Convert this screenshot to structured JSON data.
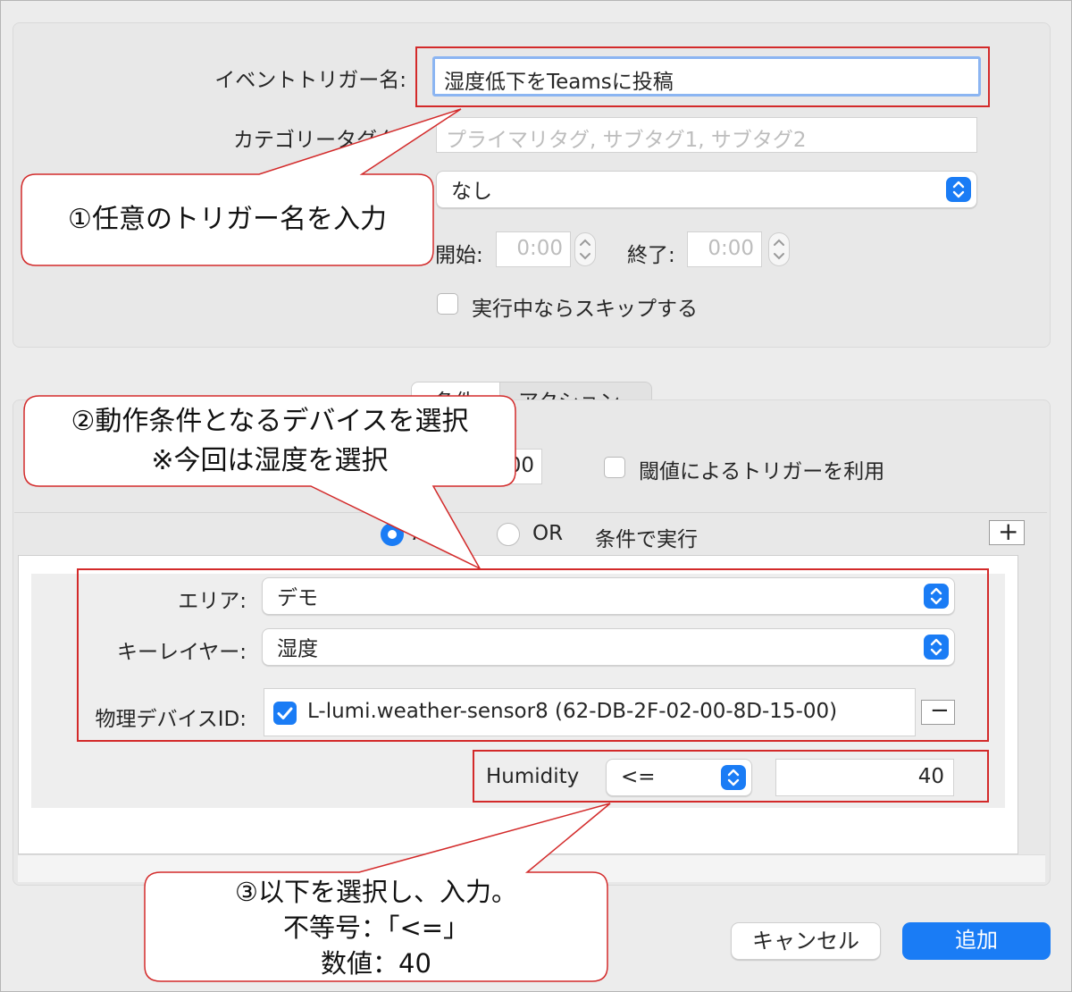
{
  "trigger_form": {
    "event_name_label": "イベントトリガー名:",
    "event_name_value": "湿度低下をTeamsに投稿",
    "category_label": "カテゴリータグタ",
    "category_placeholder": "プライマリタグ, サブタグ1, サブタグ2",
    "schedule_value": "なし",
    "start_label": "開始:",
    "start_value": "0:00",
    "end_label": "終了:",
    "end_value": "0:00",
    "skip_label": "実行中ならスキップする"
  },
  "tabs": [
    {
      "label": "条件",
      "selected": true
    },
    {
      "label": "アクション",
      "selected": false
    }
  ],
  "conditions": {
    "partial_value": "00",
    "threshold_label": "閾値によるトリガーを利用",
    "and_label": "AND",
    "or_label": "OR",
    "run_suffix": "条件で実行",
    "add_symbol": "+",
    "area_label": "エリア:",
    "area_value": "デモ",
    "layer_label": "キーレイヤー:",
    "layer_value": "湿度",
    "device_label": "物理デバイスID:",
    "device_value": "L-lumi.weather-sensor8 (62-DB-2F-02-00-8D-15-00)",
    "remove_symbol": "−",
    "humidity_label": "Humidity",
    "operator_value": "<=",
    "threshold_value": "40"
  },
  "footer": {
    "cancel_label": "キャンセル",
    "add_label": "追加"
  },
  "callouts": {
    "c1": "①任意のトリガー名を入力",
    "c2_line1": "②動作条件となるデバイスを選択",
    "c2_line2": "※今回は湿度を選択",
    "c3_line1": "③以下を選択し、入力。",
    "c3_line2": "不等号：「<=」",
    "c3_line3": "数値：40"
  },
  "colors": {
    "accent": "#1a7cf5",
    "annotation_red": "#d32a2a"
  }
}
